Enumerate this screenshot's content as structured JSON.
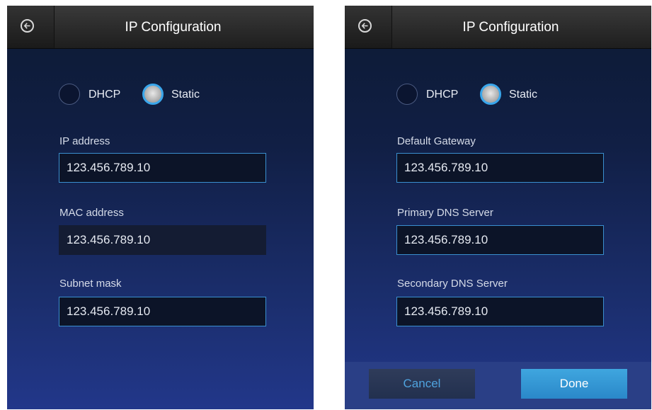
{
  "left_screen": {
    "title": "IP Configuration",
    "mode_options": [
      "DHCP",
      "Static"
    ],
    "selected_mode": "Static",
    "fields": [
      {
        "label": "IP address",
        "value": "123.456.789.10"
      },
      {
        "label": "MAC address",
        "value": "123.456.789.10"
      },
      {
        "label": "Subnet mask",
        "value": "123.456.789.10"
      }
    ]
  },
  "right_screen": {
    "title": "IP Configuration",
    "mode_options": [
      "DHCP",
      "Static"
    ],
    "selected_mode": "Static",
    "fields": [
      {
        "label": "Default Gateway",
        "value": "123.456.789.10"
      },
      {
        "label": "Primary DNS Server",
        "value": "123.456.789.10"
      },
      {
        "label": "Secondary DNS Server",
        "value": "123.456.789.10"
      }
    ],
    "footer": {
      "cancel_label": "Cancel",
      "done_label": "Done"
    }
  },
  "icons": {
    "back": "back-arrow-circle-icon"
  },
  "colors": {
    "accent": "#3aa7ec",
    "done_button": "#3197d4",
    "background_top": "#0c1a33",
    "background_bottom": "#22378a"
  }
}
